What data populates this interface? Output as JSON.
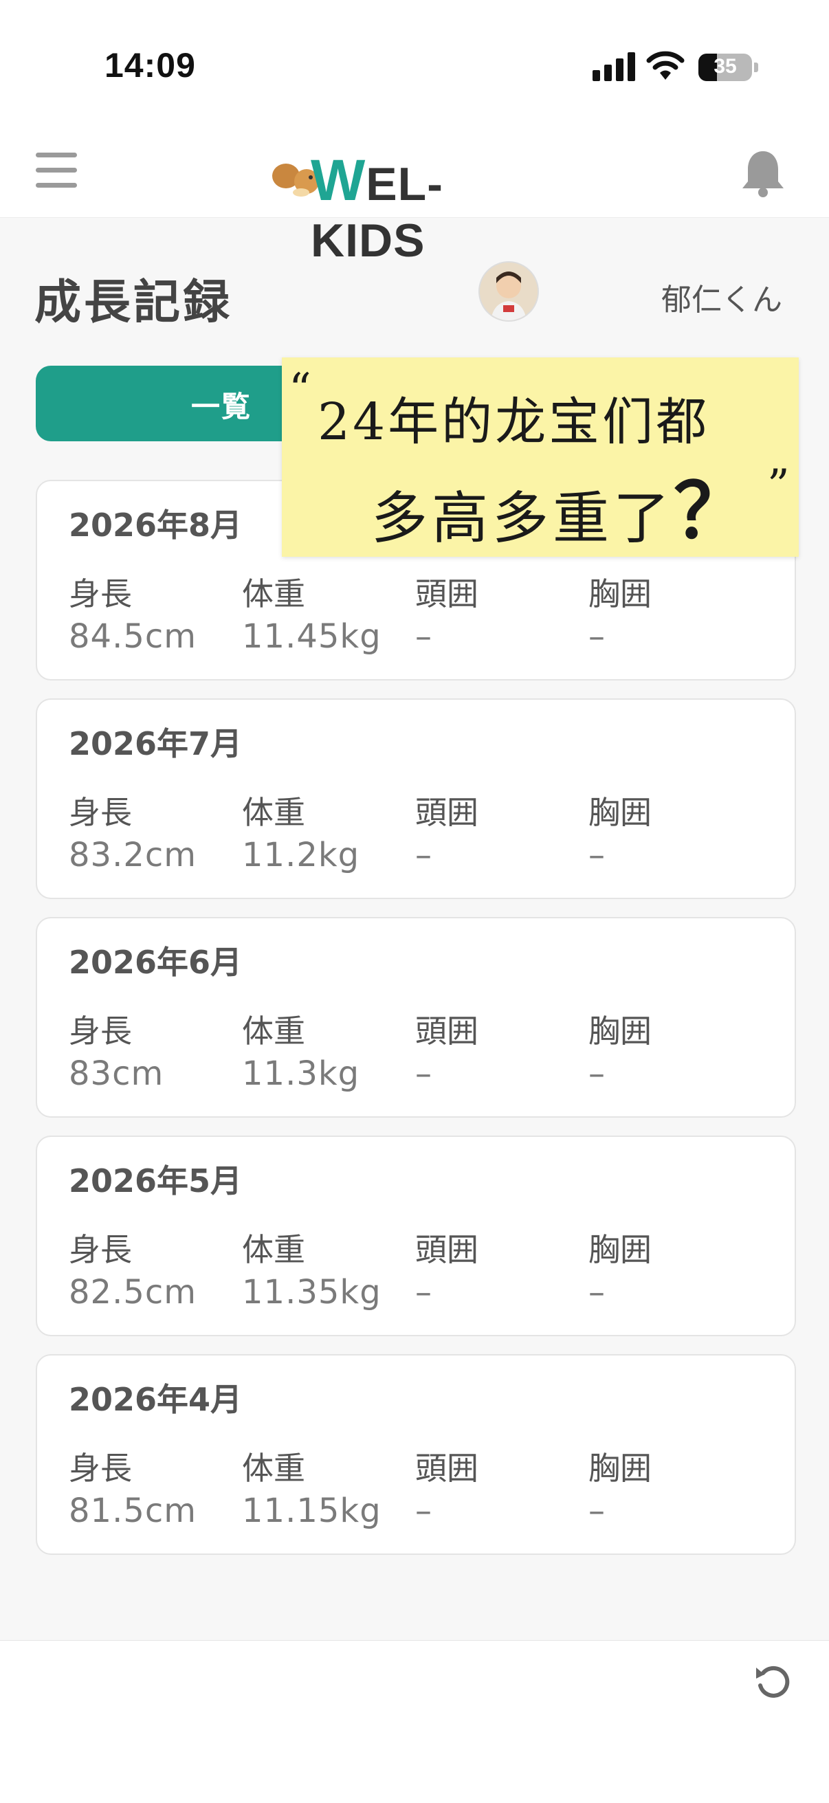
{
  "status_bar": {
    "time": "14:09",
    "battery": "35",
    "battery_level": 0.35
  },
  "header": {
    "logo_w": "W",
    "logo_text": "EL-KIDS",
    "brand_color": "#1fa593"
  },
  "page": {
    "title": "成長記録",
    "child_name": "郁仁くん"
  },
  "tabs": {
    "list_label": "一覧",
    "active_color": "#1f9e8a"
  },
  "overlay_note": {
    "open_quote": "“",
    "line1": "24年的龙宝们都",
    "line2": "多高多重了",
    "question": "？",
    "close_quote": "”"
  },
  "records": [
    {
      "date": "2026年8月",
      "height_label": "身長",
      "height": "84.5cm",
      "weight_label": "体重",
      "weight": "11.45kg",
      "head_label": "頭囲",
      "head": "–",
      "chest_label": "胸囲",
      "chest": "–"
    },
    {
      "date": "2026年7月",
      "height_label": "身長",
      "height": "83.2cm",
      "weight_label": "体重",
      "weight": "11.2kg",
      "head_label": "頭囲",
      "head": "–",
      "chest_label": "胸囲",
      "chest": "–"
    },
    {
      "date": "2026年6月",
      "height_label": "身長",
      "height": "83cm",
      "weight_label": "体重",
      "weight": "11.3kg",
      "head_label": "頭囲",
      "head": "–",
      "chest_label": "胸囲",
      "chest": "–"
    },
    {
      "date": "2026年5月",
      "height_label": "身長",
      "height": "82.5cm",
      "weight_label": "体重",
      "weight": "11.35kg",
      "head_label": "頭囲",
      "head": "–",
      "chest_label": "胸囲",
      "chest": "–"
    },
    {
      "date": "2026年4月",
      "height_label": "身長",
      "height": "81.5cm",
      "weight_label": "体重",
      "weight": "11.15kg",
      "head_label": "頭囲",
      "head": "–",
      "chest_label": "胸囲",
      "chest": "–"
    }
  ],
  "icons": [
    "menu-icon",
    "squirrel-logo-icon",
    "bell-icon",
    "refresh-icon",
    "signal-icon",
    "wifi-icon",
    "battery-icon"
  ]
}
